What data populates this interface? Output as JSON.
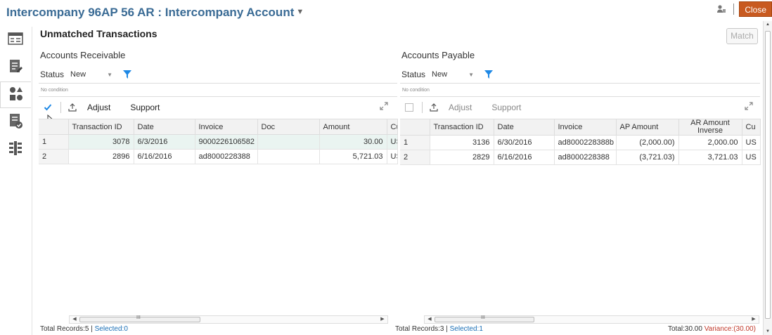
{
  "window": {
    "title": "Intercompany 96AP 56 AR : Intercompany Account",
    "close_label": "Close"
  },
  "page": {
    "section_title": "Unmatched Transactions",
    "match_label": "Match"
  },
  "icons": {
    "rail": [
      "list-detail-icon",
      "edit-notes-icon",
      "shapes-icon",
      "checked-notes-icon",
      "split-view-icon"
    ],
    "top": "user-settings-icon",
    "filter": "filter-icon",
    "export": "export-icon",
    "expand": "expand-icon"
  },
  "colors": {
    "title_blue": "#3a6b95",
    "close_orange": "#c85a20",
    "link_blue": "#1a6fb6",
    "variance_red": "#c0392b",
    "filter_blue": "#1e88e5"
  },
  "ar": {
    "title": "Accounts Receivable",
    "status_label": "Status",
    "status_value": "New",
    "condition": "No condition",
    "adjust_label": "Adjust",
    "support_label": "Support",
    "columns": [
      "",
      "Transaction ID",
      "Date",
      "Invoice",
      "Doc",
      "Amount",
      "Cu"
    ],
    "rows": [
      [
        "1",
        "3078",
        "6/3/2016",
        "9000226106582",
        "",
        "30.00",
        "US"
      ],
      [
        "2",
        "2896",
        "6/16/2016",
        "ad8000228388",
        "",
        "5,721.03",
        "US"
      ]
    ],
    "scroll_grip": "III",
    "footer_total": "Total Records:5 | ",
    "footer_selected": "Selected:0"
  },
  "ap": {
    "title": "Accounts Payable",
    "status_label": "Status",
    "status_value": "New",
    "condition": "No condition",
    "adjust_label": "Adjust",
    "support_label": "Support",
    "columns": [
      "",
      "Transaction ID",
      "Date",
      "Invoice",
      "AP Amount",
      "AR Amount Inverse",
      "Cu"
    ],
    "rows": [
      [
        "1",
        "3136",
        "6/30/2016",
        "ad8000228388b",
        "(2,000.00)",
        "2,000.00",
        "US"
      ],
      [
        "2",
        "2829",
        "6/16/2016",
        "ad8000228388",
        "(3,721.03)",
        "3,721.03",
        "US"
      ]
    ],
    "scroll_grip": "III",
    "footer_total": "Total Records:3 | ",
    "footer_selected": "Selected:1",
    "summary_total": "Total:30.00 ",
    "summary_variance": "Variance:(30.00)"
  }
}
